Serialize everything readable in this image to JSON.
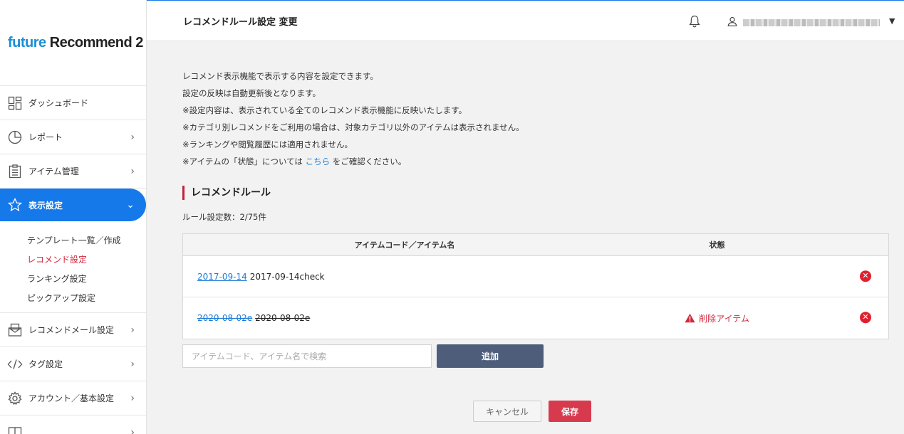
{
  "brand": {
    "logo_part1": "future",
    "logo_part2": "Recommend 2",
    "accent": "#1579e9",
    "danger": "#d1293d"
  },
  "sidebar": {
    "items": [
      {
        "label": "ダッシュボード",
        "icon": "dashboard-icon"
      },
      {
        "label": "レポート",
        "icon": "pie-chart-icon"
      },
      {
        "label": "アイテム管理",
        "icon": "clipboard-icon"
      },
      {
        "label": "表示設定",
        "icon": "star-icon"
      },
      {
        "label": "レコメンドメール設定",
        "icon": "mail-icon"
      },
      {
        "label": "タグ設定",
        "icon": "code-icon"
      },
      {
        "label": "アカウント／基本設定",
        "icon": "gear-icon"
      }
    ],
    "subitems": [
      "テンプレート一覧／作成",
      "レコメンド設定",
      "ランキング設定",
      "ピックアップ設定"
    ],
    "current_subitem": "レコメンド設定"
  },
  "header": {
    "title": "レコメンドルール設定 変更"
  },
  "description": {
    "lines": [
      "レコメンド表示機能で表示する内容を設定できます。",
      "設定の反映は自動更新後となります。",
      "※設定内容は、表示されている全てのレコメンド表示機能に反映いたします。",
      "※カテゴリ別レコメンドをご利用の場合は、対象カテゴリ以外のアイテムは表示されません。",
      "※ランキングや閲覧履歴には適用されません。"
    ],
    "last_prefix": "※アイテムの「状態」については",
    "last_link": "こちら",
    "last_suffix": "をご確認ください。"
  },
  "section": {
    "title": "レコメンドルール",
    "count_label": "ルール設定数：2/75件"
  },
  "table": {
    "headers": [
      "アイテムコード／アイテム名",
      "状態"
    ],
    "rows": [
      {
        "code": "2017-09-14",
        "name": "2017-09-14check",
        "status": "",
        "deleted": false
      },
      {
        "code": "2020-08-02e",
        "name": "2020-08-02e",
        "status": "削除アイテム",
        "deleted": true
      }
    ]
  },
  "search": {
    "placeholder": "アイテムコード、アイテム名で検索",
    "add_label": "追加"
  },
  "footer": {
    "cancel_label": "キャンセル",
    "save_label": "保存"
  }
}
